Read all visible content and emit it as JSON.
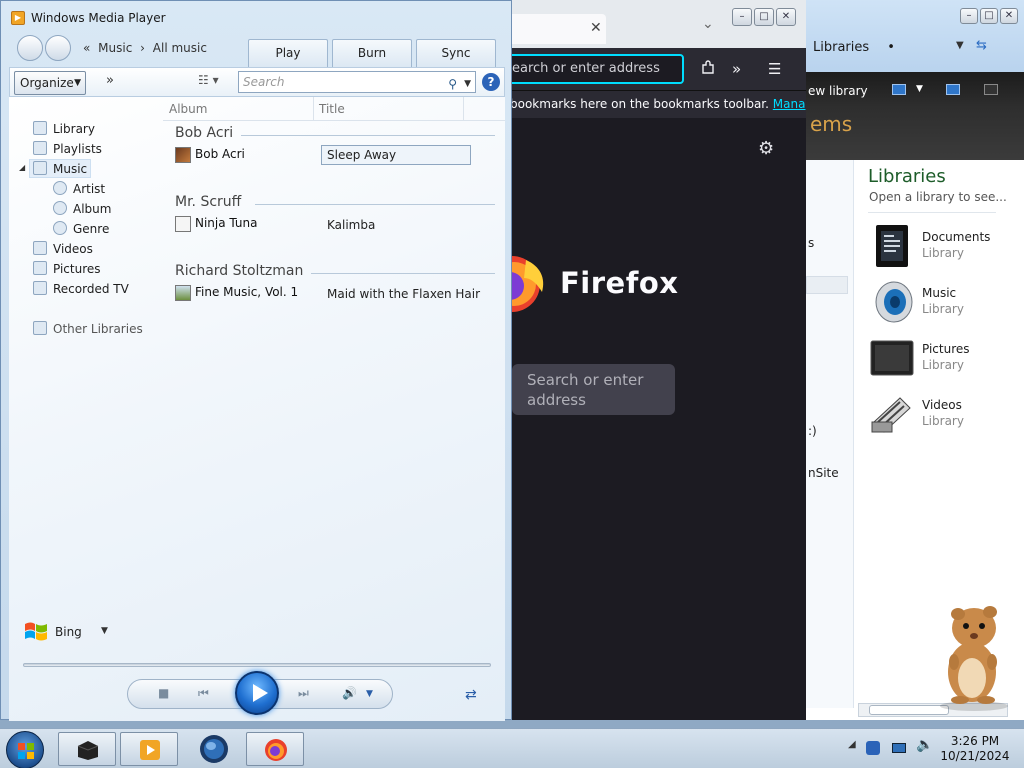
{
  "wmp": {
    "title": "Windows Media Player",
    "breadcrumb": {
      "sep": "«",
      "level1": "Music",
      "arrow": "›",
      "level2": "All music"
    },
    "tabs": {
      "play": "Play",
      "burn": "Burn",
      "sync": "Sync"
    },
    "toolbar": {
      "organize": "Organize",
      "more": "»",
      "search_placeholder": "Search",
      "help": "?"
    },
    "nav": {
      "library": "Library",
      "playlists": "Playlists",
      "music": "Music",
      "artist": "Artist",
      "album": "Album",
      "genre": "Genre",
      "videos": "Videos",
      "pictures": "Pictures",
      "recorded_tv": "Recorded TV",
      "other_libraries": "Other Libraries"
    },
    "columns": {
      "album": "Album",
      "title": "Title"
    },
    "groups": [
      {
        "artist": "Bob Acri",
        "album": "Bob Acri",
        "title": "Sleep Away"
      },
      {
        "artist": "Mr. Scruff",
        "album": "Ninja Tuna",
        "title": "Kalimba"
      },
      {
        "artist": "Richard Stoltzman",
        "album": "Fine Music, Vol. 1",
        "title": "Maid with the Flaxen Hair"
      }
    ],
    "bing": "Bing",
    "controls": {
      "stop": "■",
      "prev": "⏮",
      "next": "⏭",
      "volume": "🔊",
      "switch": "⇄"
    }
  },
  "firefox": {
    "tab_close": "✕",
    "urlbar_text": "earch or enter address",
    "bookmarks_text": "bookmarks here on the bookmarks toolbar.",
    "bookmarks_link": "Manage bo",
    "wordmark": "Firefox",
    "search_text": "Search or enter address"
  },
  "explorer": {
    "breadcrumb": "Libraries",
    "crumb_bullet": "•",
    "new_library": "ew library",
    "toolbar_partial": "ems",
    "heading": "Libraries",
    "subtitle": "Open a library to see...",
    "left_partial": {
      "a": "s",
      "b": ":)",
      "c": "nSite"
    },
    "items": [
      {
        "name": "Documents",
        "type": "Library"
      },
      {
        "name": "Music",
        "type": "Library"
      },
      {
        "name": "Pictures",
        "type": "Library"
      },
      {
        "name": "Videos",
        "type": "Library"
      }
    ]
  },
  "taskbar": {
    "time": "3:26 PM",
    "date": "10/21/2024"
  },
  "colors": {
    "firefox_bg": "#1c1b22",
    "firefox_accent": "#00ddff",
    "wmp_play": "#1f6fd0",
    "explorer_heading": "#1d5c29"
  }
}
